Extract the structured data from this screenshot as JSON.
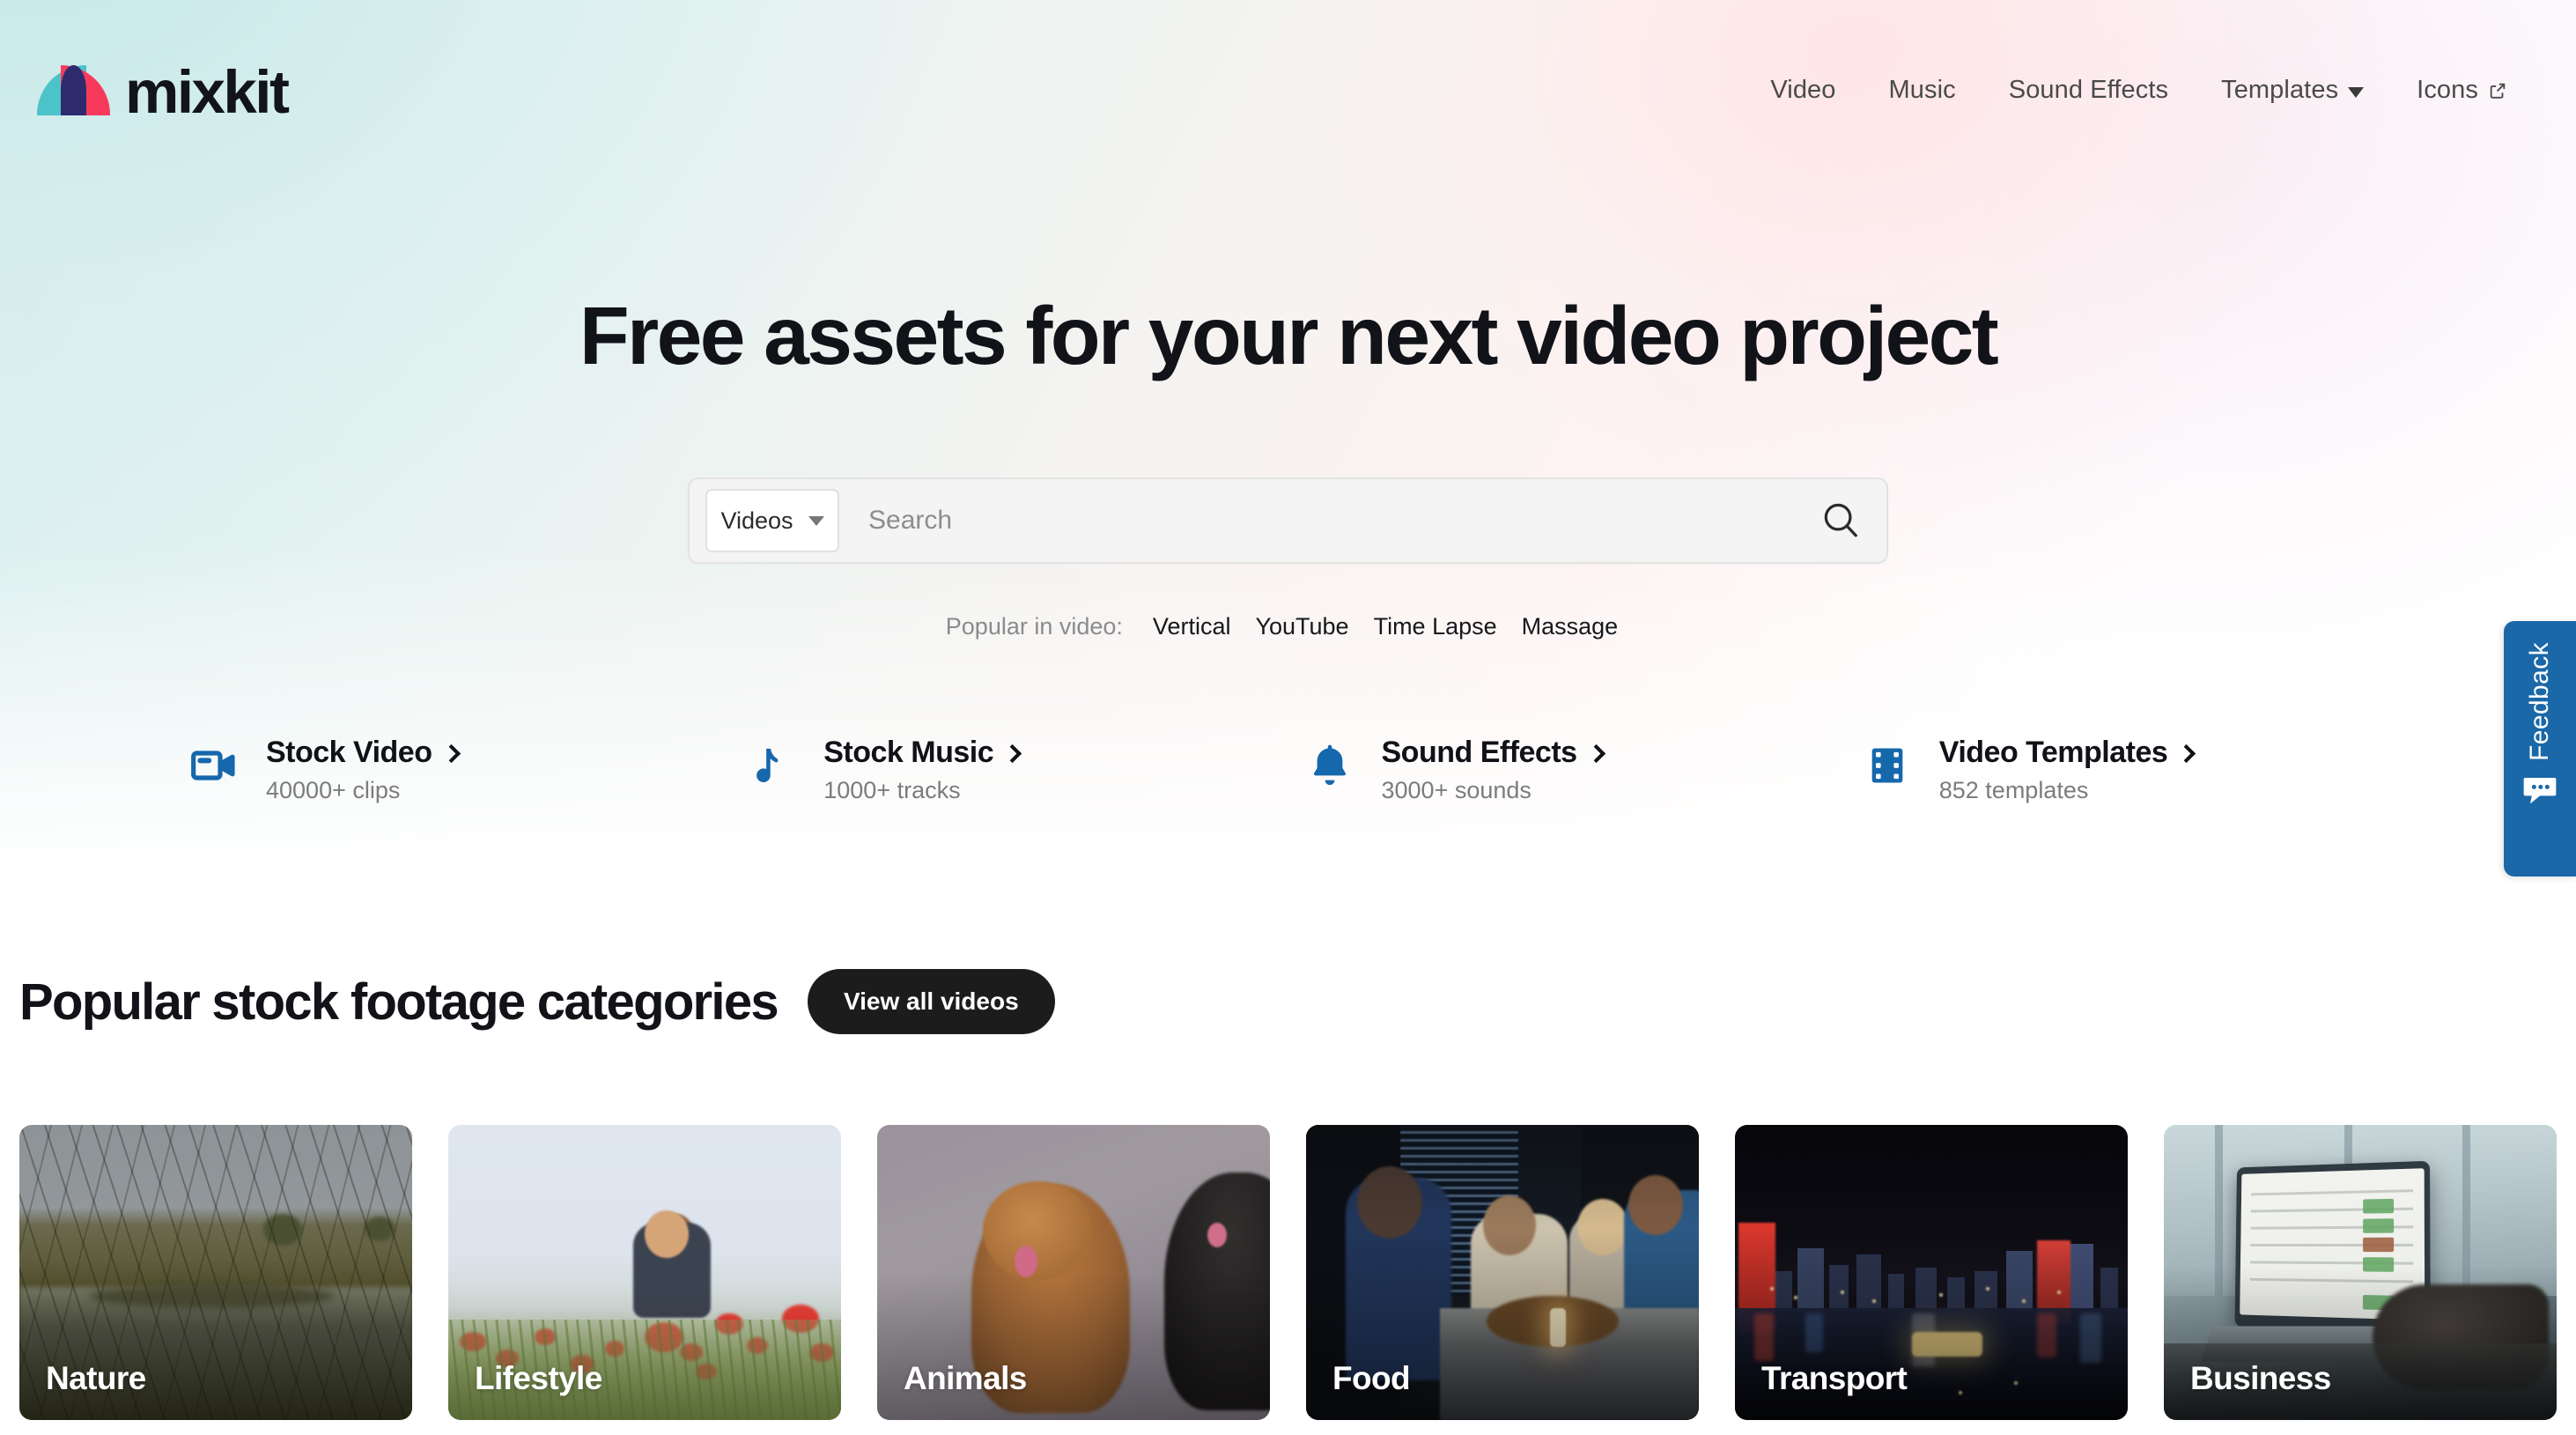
{
  "brand": {
    "name": "mixkit",
    "logo_colors": {
      "teal": "#4cc3c9",
      "red": "#f73a5c",
      "navy": "#2e2a6e"
    }
  },
  "nav": {
    "items": [
      {
        "label": "Video",
        "icon": "",
        "has_dropdown": false
      },
      {
        "label": "Music",
        "icon": "",
        "has_dropdown": false
      },
      {
        "label": "Sound Effects",
        "icon": "",
        "has_dropdown": false
      },
      {
        "label": "Templates",
        "icon": "chevron-down-icon",
        "has_dropdown": true
      },
      {
        "label": "Icons",
        "icon": "external-link-icon",
        "has_dropdown": false
      }
    ]
  },
  "hero": {
    "title": "Free assets for your next video project"
  },
  "search": {
    "type_label": "Videos",
    "placeholder": "Search",
    "value": "",
    "submit_icon": "search-icon"
  },
  "popular": {
    "label": "Popular in video:",
    "links": [
      "Vertical",
      "YouTube",
      "Time Lapse",
      "Massage"
    ]
  },
  "quicklinks": {
    "accent_color": "#1668ad",
    "items": [
      {
        "icon": "video-camera-icon",
        "title": "Stock Video",
        "count": "40000+ clips"
      },
      {
        "icon": "music-note-icon",
        "title": "Stock Music",
        "count": "1000+ tracks"
      },
      {
        "icon": "bell-icon",
        "title": "Sound Effects",
        "count": "3000+ sounds"
      },
      {
        "icon": "film-strip-icon",
        "title": "Video Templates",
        "count": "852 templates"
      }
    ]
  },
  "categories_section": {
    "title": "Popular stock footage categories",
    "view_all_label": "View all videos",
    "cards": [
      {
        "label": "Nature"
      },
      {
        "label": "Lifestyle"
      },
      {
        "label": "Animals"
      },
      {
        "label": "Food"
      },
      {
        "label": "Transport"
      },
      {
        "label": "Business"
      }
    ]
  },
  "feedback": {
    "label": "Feedback",
    "icon": "speech-bubble-icon",
    "color": "#1a68a8"
  }
}
